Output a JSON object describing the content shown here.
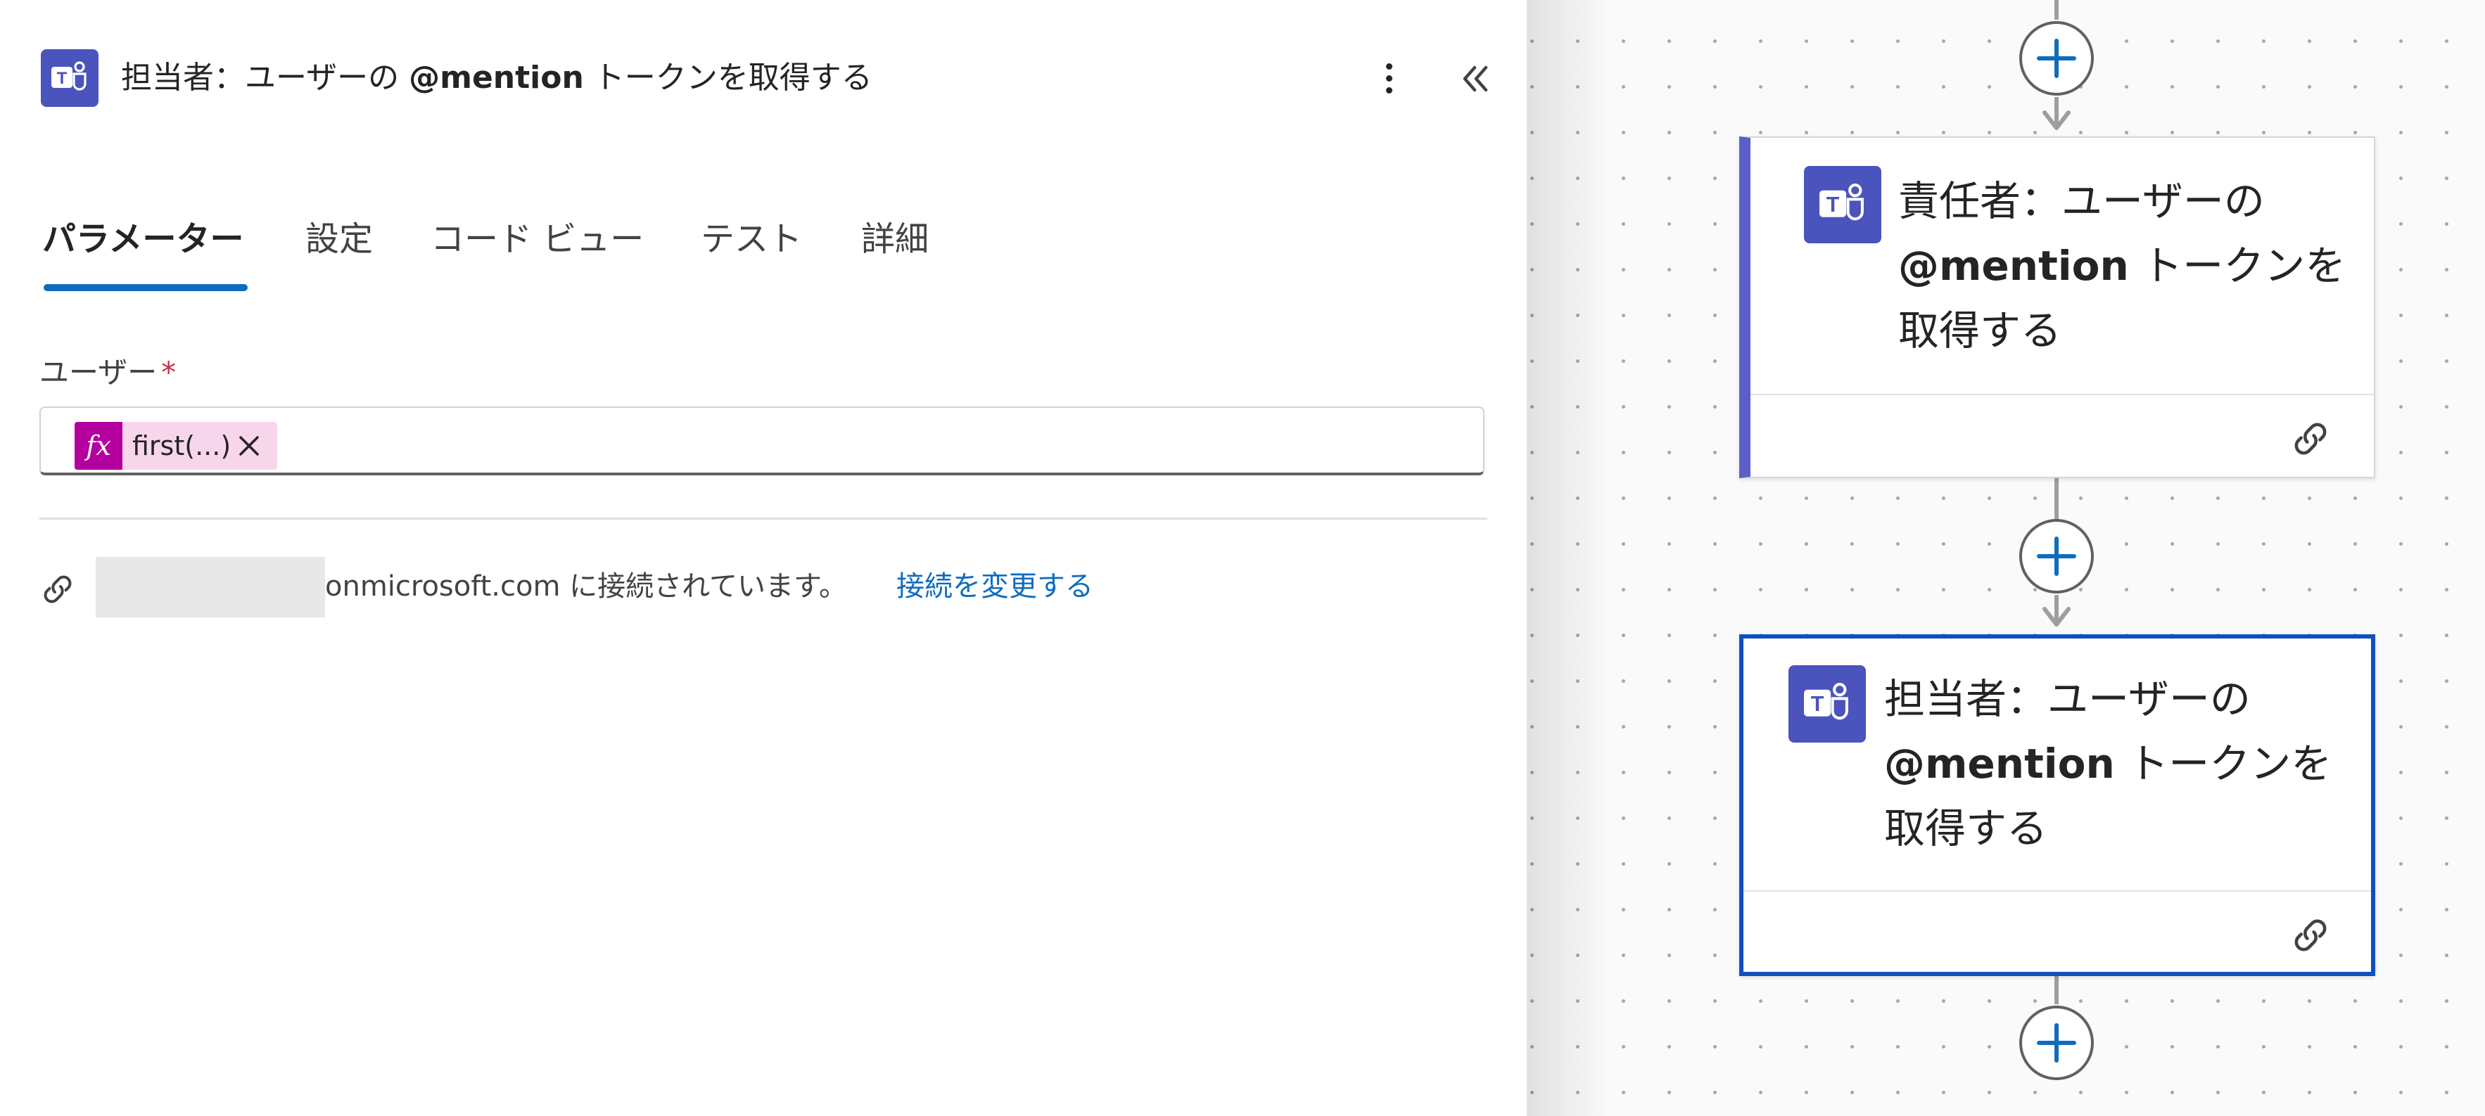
{
  "panel": {
    "title_prefix": "担当者：ユーザーの ",
    "title_bold": "@mention",
    "title_suffix": " トークンを取得する",
    "icons": {
      "app": "teams-icon",
      "more": "more-vertical-icon",
      "collapse": "chevron-double-left-icon"
    }
  },
  "tabs": [
    {
      "label": "パラメーター",
      "active": true
    },
    {
      "label": "設定",
      "active": false
    },
    {
      "label": "コード ビュー",
      "active": false
    },
    {
      "label": "テスト",
      "active": false
    },
    {
      "label": "詳細",
      "active": false
    }
  ],
  "field": {
    "label": "ユーザー",
    "required_mark": "*",
    "token_text": "first(...)",
    "token_icon": "fx"
  },
  "connection": {
    "status_text": "onmicrosoft.com に接続されています。",
    "change_link": "接続を変更する"
  },
  "canvas": {
    "cards": [
      {
        "title_prefix": "責任者：ユーザーの",
        "title_bold": "@mention",
        "title_suffix": " トークンを",
        "title_line3": "取得する",
        "selected": false
      },
      {
        "title_prefix": "担当者：ユーザーの",
        "title_bold": "@mention",
        "title_suffix": " トークンを",
        "title_line3": "取得する",
        "selected": true
      }
    ]
  },
  "colors": {
    "teams": "#4b53bc",
    "accent": "#0f6cbd",
    "selected_border": "#0f4fbf",
    "fx": "#b4009e",
    "token_bg": "#f7d6ec"
  }
}
